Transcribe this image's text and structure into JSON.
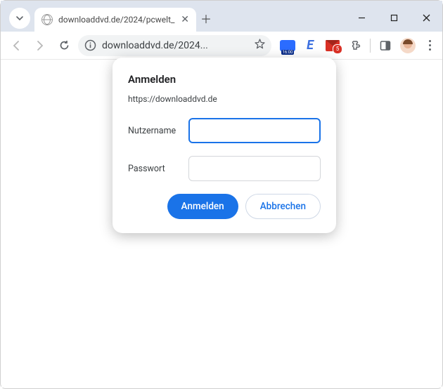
{
  "window": {
    "tab_title": "downloaddvd.de/2024/pcwelt_",
    "url_display": "downloaddvd.de/2024..."
  },
  "extensions": {
    "blue_badge": "16:00",
    "mail_badge": "5"
  },
  "dialog": {
    "title": "Anmelden",
    "site": "https://downloaddvd.de",
    "username_label": "Nutzername",
    "password_label": "Passwort",
    "username_value": "",
    "password_value": "",
    "submit_label": "Anmelden",
    "cancel_label": "Abbrechen"
  }
}
